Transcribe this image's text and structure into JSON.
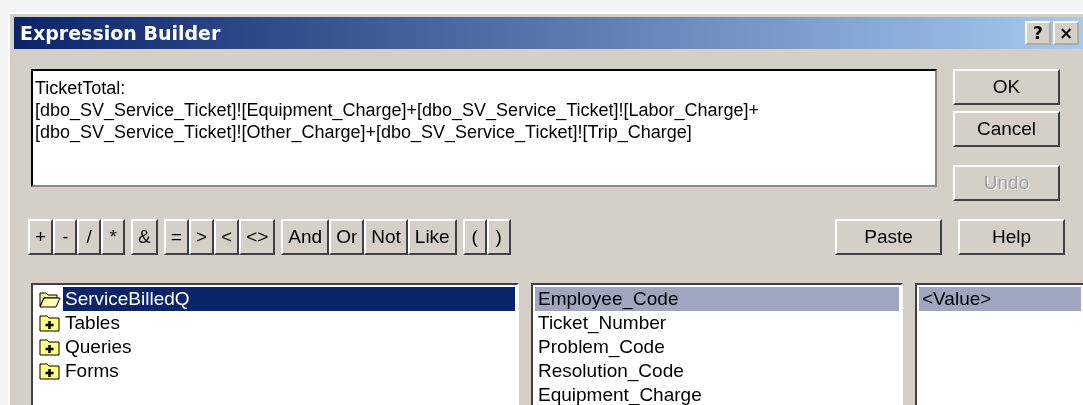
{
  "window": {
    "title": "Expression Builder",
    "title_buttons": [
      {
        "label": "?",
        "kind": "help"
      },
      {
        "label": "×",
        "kind": "close"
      }
    ]
  },
  "expression": {
    "lines": [
      "TicketTotal:",
      "[dbo_SV_Service_Ticket]![Equipment_Charge]+[dbo_SV_Service_Ticket]![Labor_Charge]+",
      "[dbo_SV_Service_Ticket]![Other_Charge]+[dbo_SV_Service_Ticket]![Trip_Charge]"
    ]
  },
  "side_buttons": [
    {
      "label": "OK",
      "disabled": false
    },
    {
      "label": "Cancel",
      "disabled": false
    },
    {
      "label": "Undo",
      "disabled": true
    }
  ],
  "operator_groups": [
    [
      "+",
      "-",
      "/",
      "*"
    ],
    [
      "&"
    ],
    [
      "=",
      ">",
      "<",
      "<>"
    ],
    [
      "And",
      "Or",
      "Not",
      "Like"
    ],
    [
      "(",
      ")"
    ]
  ],
  "paste_button": {
    "label": "Paste"
  },
  "help_button": {
    "label": "Help"
  },
  "object_tree": [
    {
      "label": "ServiceBilledQ",
      "expanded": true,
      "selected": true
    },
    {
      "label": "Tables",
      "expanded": false,
      "selected": false
    },
    {
      "label": "Queries",
      "expanded": false,
      "selected": false
    },
    {
      "label": "Forms",
      "expanded": false,
      "selected": false
    }
  ],
  "field_list": [
    {
      "label": "Employee_Code",
      "selected": true
    },
    {
      "label": "Ticket_Number",
      "selected": false
    },
    {
      "label": "Problem_Code",
      "selected": false
    },
    {
      "label": "Resolution_Code",
      "selected": false
    },
    {
      "label": "Equipment_Charge",
      "selected": false
    }
  ],
  "value_list": [
    {
      "label": "<Value>",
      "selected": true
    }
  ]
}
